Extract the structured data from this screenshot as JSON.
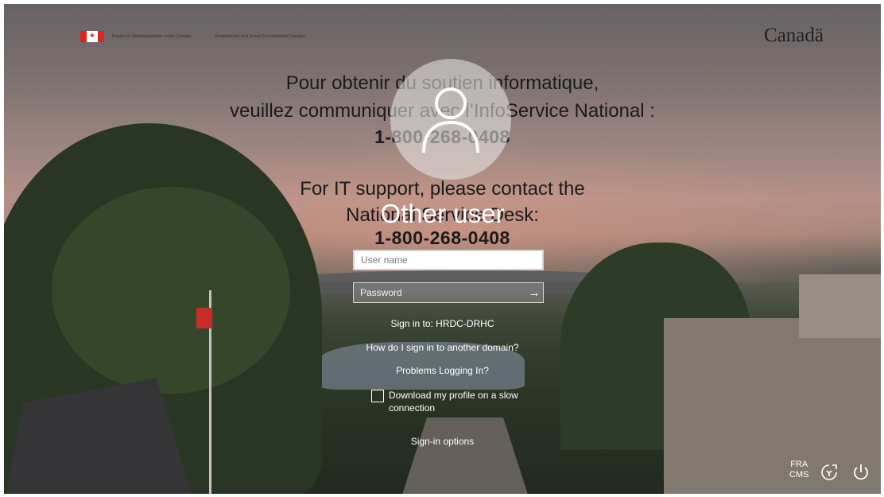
{
  "header": {
    "dept_fr": "Emploi et Développement social Canada",
    "dept_en": "Employment and Social Development Canada",
    "wordmark": "Canadä"
  },
  "support": {
    "fr_line1": "Pour obtenir du soutien informatique,",
    "fr_line2": "veuillez communiquer avec l’InfoService National :",
    "fr_phone": "1-800-268-0408",
    "en_line1": "For IT support, please contact the",
    "en_line2": "National Service Desk:",
    "en_phone": "1-800-268-0408"
  },
  "user": {
    "title": "Other user"
  },
  "form": {
    "username_placeholder": "User name",
    "password_placeholder": "Password",
    "sign_in_to": "Sign in to: HRDC-DRHC",
    "other_domain": "How do I sign in to another domain?",
    "problems": "Problems Logging In?",
    "slow_connection": "Download my profile on a slow connection",
    "sign_in_options": "Sign-in options"
  },
  "footer": {
    "lang_primary": "FRA",
    "lang_secondary": "CMS"
  }
}
